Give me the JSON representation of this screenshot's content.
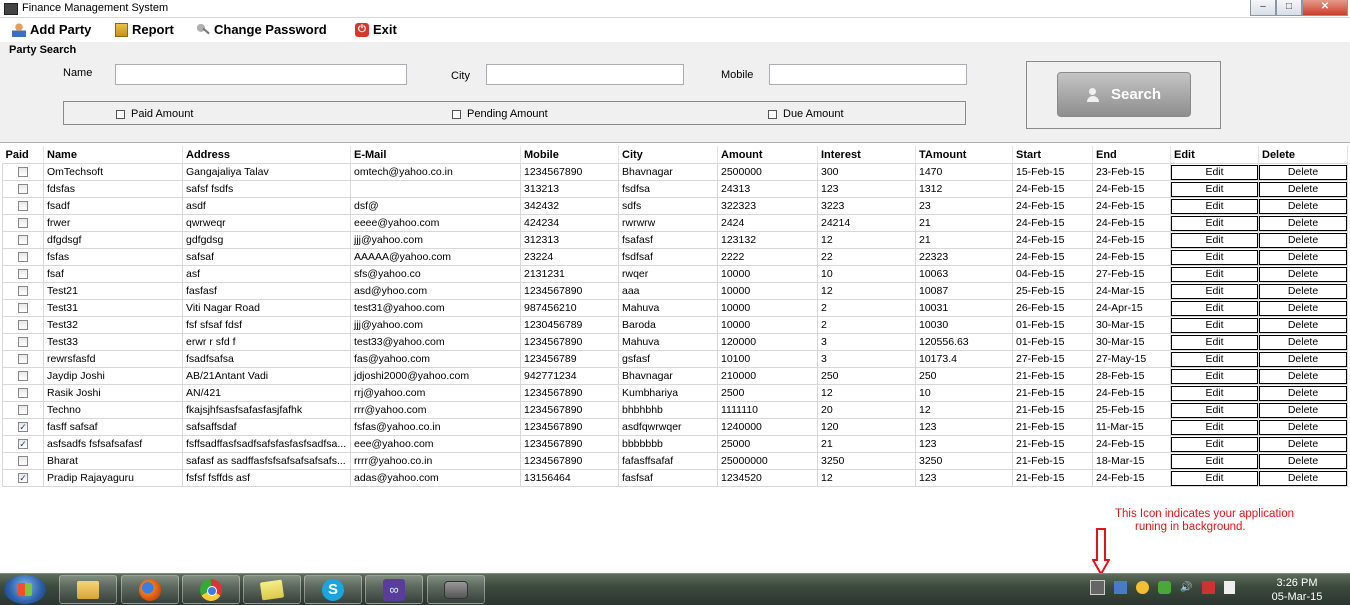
{
  "window": {
    "title": "Finance Management System",
    "min": "–",
    "max": "□",
    "close": "✕"
  },
  "menu": [
    {
      "label": "Add Party",
      "icon": "user-icon"
    },
    {
      "label": "Report",
      "icon": "report-icon"
    },
    {
      "label": "Change Password",
      "icon": "key-icon"
    },
    {
      "label": "Exit",
      "icon": "exit-icon"
    }
  ],
  "search": {
    "section_title": "Party Search",
    "name_label": "Name",
    "name_value": "",
    "city_label": "City",
    "city_value": "",
    "mobile_label": "Mobile",
    "mobile_value": "",
    "paid_amount_label": "Paid Amount",
    "pending_amount_label": "Pending Amount",
    "due_amount_label": "Due Amount",
    "button_label": "Search"
  },
  "grid": {
    "columns": [
      "Paid",
      "Name",
      "Address",
      "E-Mail",
      "Mobile",
      "City",
      "Amount",
      "Interest",
      "TAmount",
      "Start",
      "End",
      "Edit",
      "Delete"
    ],
    "edit_label": "Edit",
    "delete_label": "Delete",
    "rows": [
      {
        "paid": false,
        "name": "OmTechsoft",
        "address": "Gangajaliya Talav",
        "email": "omtech@yahoo.co.in",
        "mobile": "1234567890",
        "city": "Bhavnagar",
        "amount": "2500000",
        "interest": "300",
        "tamount": "1470",
        "start": "15-Feb-15",
        "end": "23-Feb-15"
      },
      {
        "paid": false,
        "name": "fdsfas",
        "address": "safsf fsdfs",
        "email": "",
        "mobile": "313213",
        "city": "fsdfsa",
        "amount": "24313",
        "interest": "123",
        "tamount": "1312",
        "start": "24-Feb-15",
        "end": "24-Feb-15"
      },
      {
        "paid": false,
        "name": "fsadf",
        "address": "asdf",
        "email": "dsf@",
        "mobile": "342432",
        "city": "sdfs",
        "amount": "322323",
        "interest": "3223",
        "tamount": "23",
        "start": "24-Feb-15",
        "end": "24-Feb-15"
      },
      {
        "paid": false,
        "name": "frwer",
        "address": "qwrweqr",
        "email": "eeee@yahoo.com",
        "mobile": "424234",
        "city": "rwrwrw",
        "amount": "2424",
        "interest": "24214",
        "tamount": "21",
        "start": "24-Feb-15",
        "end": "24-Feb-15"
      },
      {
        "paid": false,
        "name": "dfgdsgf",
        "address": "gdfgdsg",
        "email": "jjj@yahoo.com",
        "mobile": "312313",
        "city": "fsafasf",
        "amount": "123132",
        "interest": "12",
        "tamount": "21",
        "start": "24-Feb-15",
        "end": "24-Feb-15"
      },
      {
        "paid": false,
        "name": "fsfas",
        "address": "safsaf",
        "email": "AAAAA@yahoo.com",
        "mobile": "23224",
        "city": "fsdfsaf",
        "amount": "2222",
        "interest": "22",
        "tamount": "22323",
        "start": "24-Feb-15",
        "end": "24-Feb-15"
      },
      {
        "paid": false,
        "name": "fsaf",
        "address": "asf",
        "email": "sfs@yahoo.co",
        "mobile": "2131231",
        "city": "rwqer",
        "amount": "10000",
        "interest": "10",
        "tamount": "10063",
        "start": "04-Feb-15",
        "end": "27-Feb-15"
      },
      {
        "paid": false,
        "name": "Test21",
        "address": "fasfasf",
        "email": "asd@yhoo.com",
        "mobile": "1234567890",
        "city": "aaa",
        "amount": "10000",
        "interest": "12",
        "tamount": "10087",
        "start": "25-Feb-15",
        "end": "24-Mar-15"
      },
      {
        "paid": false,
        "name": "Test31",
        "address": "Viti Nagar Road",
        "email": "test31@yahoo.com",
        "mobile": "987456210",
        "city": "Mahuva",
        "amount": "10000",
        "interest": "2",
        "tamount": "10031",
        "start": "26-Feb-15",
        "end": "24-Apr-15"
      },
      {
        "paid": false,
        "name": "Test32",
        "address": "fsf sfsaf fdsf",
        "email": "jjj@yahoo.com",
        "mobile": "1230456789",
        "city": "Baroda",
        "amount": "10000",
        "interest": "2",
        "tamount": "10030",
        "start": "01-Feb-15",
        "end": "30-Mar-15"
      },
      {
        "paid": false,
        "name": "Test33",
        "address": "erwr r sfd f",
        "email": "test33@yahoo.com",
        "mobile": "1234567890",
        "city": "Mahuva",
        "amount": "120000",
        "interest": "3",
        "tamount": "120556.63",
        "start": "01-Feb-15",
        "end": "30-Mar-15"
      },
      {
        "paid": false,
        "name": "rewrsfasfd",
        "address": "fsadfsafsa",
        "email": "fas@yahoo.com",
        "mobile": "123456789",
        "city": "gsfasf",
        "amount": "10100",
        "interest": "3",
        "tamount": "10173.4",
        "start": "27-Feb-15",
        "end": "27-May-15"
      },
      {
        "paid": false,
        "name": "Jaydip Joshi",
        "address": "AB/21Antant Vadi",
        "email": "jdjoshi2000@yahoo.com",
        "mobile": "942771234",
        "city": "Bhavnagar",
        "amount": "210000",
        "interest": "250",
        "tamount": "250",
        "start": "21-Feb-15",
        "end": "28-Feb-15"
      },
      {
        "paid": false,
        "name": "Rasik Joshi",
        "address": "AN/421",
        "email": "rrj@yahoo.com",
        "mobile": "1234567890",
        "city": "Kumbhariya",
        "amount": "2500",
        "interest": "12",
        "tamount": "10",
        "start": "21-Feb-15",
        "end": "24-Feb-15"
      },
      {
        "paid": false,
        "name": "Techno",
        "address": "fkajsjhfsasfsafasfasjfafhk",
        "email": "rrr@yahoo.com",
        "mobile": "1234567890",
        "city": "bhbhbhb",
        "amount": "1111110",
        "interest": "20",
        "tamount": "12",
        "start": "21-Feb-15",
        "end": "25-Feb-15"
      },
      {
        "paid": true,
        "name": "fasff safsaf",
        "address": "safsaffsdaf",
        "email": "fsfas@yahoo.co.in",
        "mobile": "1234567890",
        "city": "asdfqwrwqer",
        "amount": "1240000",
        "interest": "120",
        "tamount": "123",
        "start": "21-Feb-15",
        "end": "11-Mar-15"
      },
      {
        "paid": true,
        "name": "asfsadfs fsfsafsafasf",
        "address": "fsffsadffasfsadfsafsfasfasfsadfsa...",
        "email": "eee@yahoo.com",
        "mobile": "1234567890",
        "city": "bbbbbbb",
        "amount": "25000",
        "interest": "21",
        "tamount": "123",
        "start": "21-Feb-15",
        "end": "24-Feb-15"
      },
      {
        "paid": false,
        "name": "Bharat",
        "address": "safasf as sadffasfsfsafsafsafsafs...",
        "email": "rrrr@yahoo.co.in",
        "mobile": "1234567890",
        "city": "fafasffsafaf",
        "amount": "25000000",
        "interest": "3250",
        "tamount": "3250",
        "start": "21-Feb-15",
        "end": "18-Mar-15"
      },
      {
        "paid": true,
        "name": "Pradip Rajayaguru",
        "address": "fsfsf fsffds asf",
        "email": "adas@yahoo.com",
        "mobile": "13156464",
        "city": "fasfsaf",
        "amount": "1234520",
        "interest": "12",
        "tamount": "123",
        "start": "21-Feb-15",
        "end": "24-Feb-15"
      }
    ]
  },
  "annotation": {
    "line1": "This Icon indicates your application",
    "line2": "runing in background."
  },
  "taskbar": {
    "apps": [
      "folder-icon",
      "firefox-icon",
      "chrome-icon",
      "sticky-notes-icon",
      "skype-icon",
      "visual-studio-icon",
      "app-icon"
    ],
    "skype_glyph": "S",
    "vs_glyph": "∞",
    "clock_time": "3:26 PM",
    "clock_date": "05-Mar-15"
  },
  "colors": {
    "annotation": "#e0141a",
    "search_button": "#a8a8a8",
    "taskbar": "#3c4a3d"
  }
}
